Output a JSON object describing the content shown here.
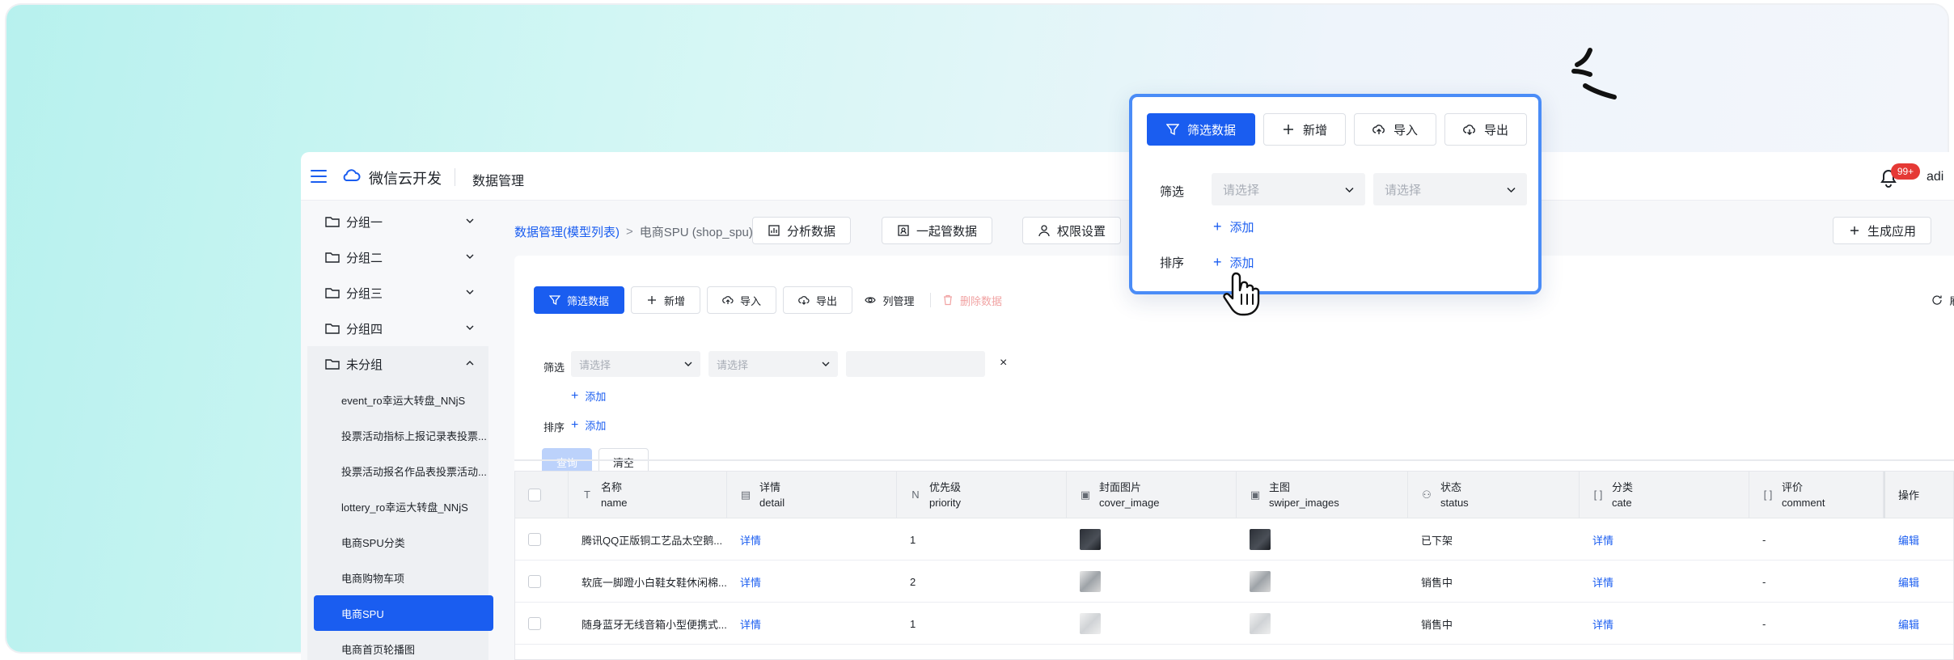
{
  "topbar": {
    "brand": "微信云开发",
    "page": "数据管理",
    "badge": "99+",
    "user": "adi"
  },
  "sidebar": {
    "groups": [
      "分组一",
      "分组二",
      "分组三",
      "分组四",
      "未分组"
    ],
    "items": [
      "event_ro幸运大转盘_NNjS",
      "投票活动指标上报记录表投票...",
      "投票活动报名作品表投票活动...",
      "lottery_ro幸运大转盘_NNjS",
      "电商SPU分类",
      "电商购物车项",
      "电商SPU",
      "电商首页轮播图"
    ]
  },
  "breadcrumb": {
    "link": "数据管理(模型列表)",
    "sep": ">",
    "current": "电商SPU (shop_spu)"
  },
  "header_buttons": {
    "analyze": "分析数据",
    "manage": "一起管数据",
    "permissions": "权限设置",
    "generate": "生成应用"
  },
  "toolbar": {
    "filter": "筛选数据",
    "add": "新增",
    "import": "导入",
    "export": "导出",
    "columns": "列管理",
    "delete": "删除数据",
    "refresh_partial": "刷"
  },
  "filter_area": {
    "filter_label": "筛选",
    "sort_label": "排序",
    "placeholder": "请选择",
    "add": "添加",
    "clear_icon": "×",
    "query": "查询",
    "clear": "清空"
  },
  "table": {
    "columns": [
      {
        "label": "名称",
        "field": "name",
        "icon": "text-type-icon"
      },
      {
        "label": "详情",
        "field": "detail",
        "icon": "document-icon"
      },
      {
        "label": "优先级",
        "field": "priority",
        "icon": "number-icon"
      },
      {
        "label": "封面图片",
        "field": "cover_image",
        "icon": "image-icon"
      },
      {
        "label": "主图",
        "field": "swiper_images",
        "icon": "image-icon"
      },
      {
        "label": "状态",
        "field": "status",
        "icon": "status-icon"
      },
      {
        "label": "分类",
        "field": "cate",
        "icon": "relation-icon"
      },
      {
        "label": "评价",
        "field": "comment",
        "icon": "relation-icon"
      },
      {
        "label": "操作",
        "field": "",
        "icon": ""
      }
    ],
    "rows": [
      {
        "name": "腾讯QQ正版铜工艺品太空鹅...",
        "detail": "详情",
        "priority": "1",
        "status": "已下架",
        "cate": "详情",
        "comment": "-",
        "action": "编辑"
      },
      {
        "name": "软底一脚蹬小白鞋女鞋休闲棉...",
        "detail": "详情",
        "priority": "2",
        "status": "销售中",
        "cate": "详情",
        "comment": "-",
        "action": "编辑"
      },
      {
        "name": "随身蓝牙无线音箱小型便携式...",
        "detail": "详情",
        "priority": "1",
        "status": "销售中",
        "cate": "详情",
        "comment": "-",
        "action": "编辑"
      }
    ]
  },
  "panel": {
    "filter": "筛选数据",
    "add": "新增",
    "import": "导入",
    "export": "导出",
    "filter_label": "筛选",
    "sort_label": "排序",
    "placeholder": "请选择",
    "add_link": "添加"
  },
  "colors": {
    "accent": "#1a5df0",
    "panel_border": "#4a8cf7",
    "badge": "#e53935"
  }
}
